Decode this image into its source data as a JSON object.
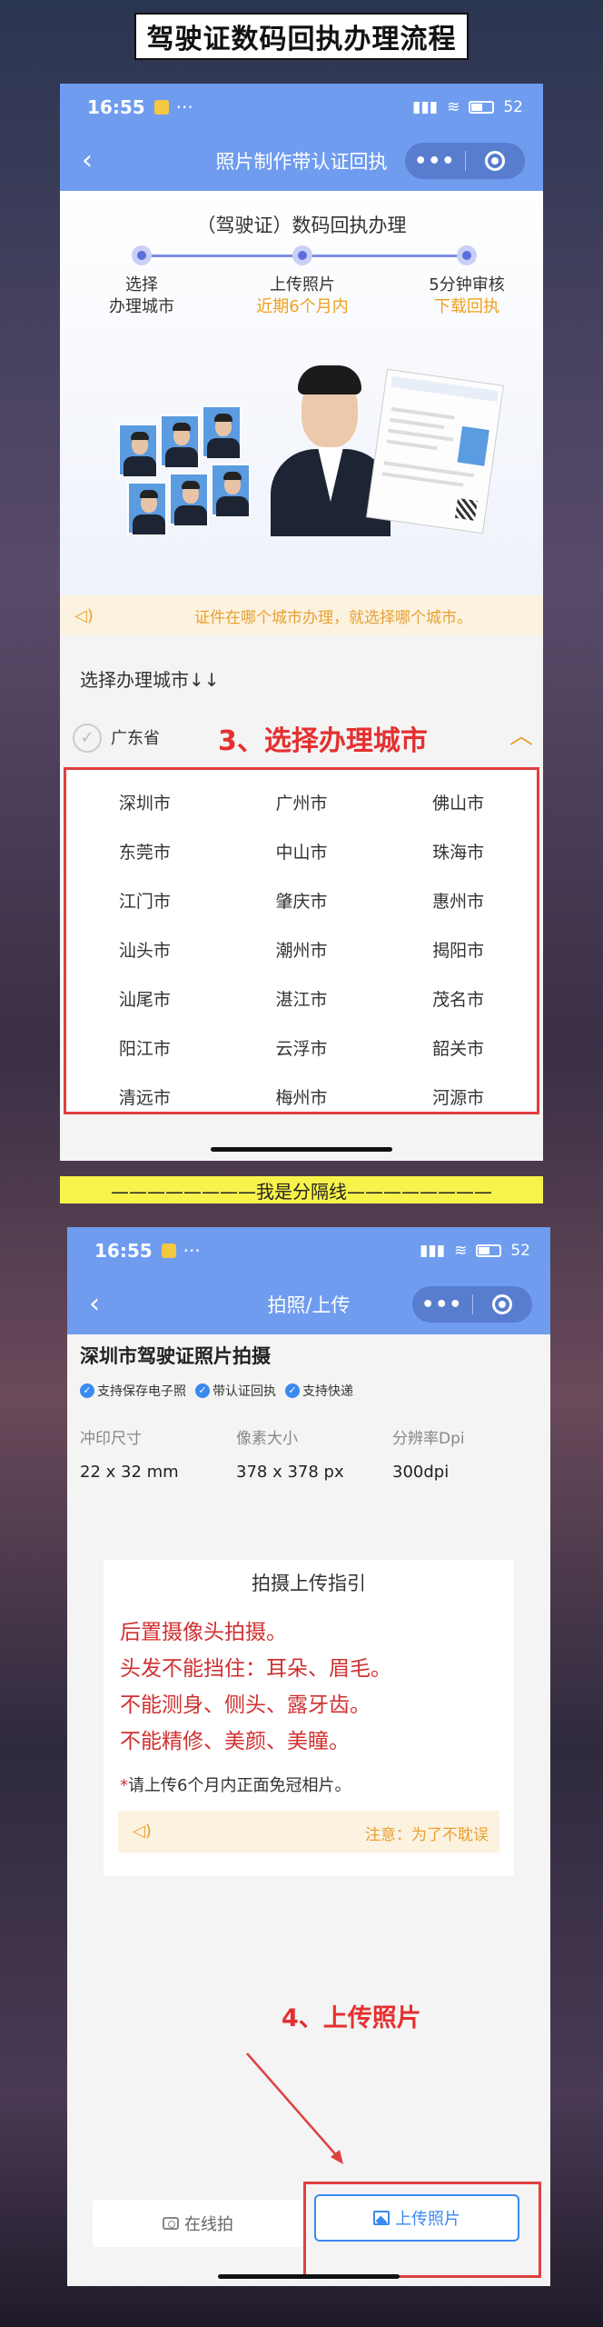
{
  "header_title": "驾驶证数码回执办理流程",
  "status_bar": {
    "time": "16:55",
    "notif_dots": "···",
    "battery": "52"
  },
  "screen1": {
    "nav_title": "照片制作带认证回执",
    "capsule_more": "•••",
    "hero_title": "（驾驶证）数码回执办理",
    "steps": [
      {
        "title": "选择",
        "sub": "办理城市",
        "sub_highlight": false
      },
      {
        "title": "上传照片",
        "sub": "近期6个月内",
        "sub_highlight": true
      },
      {
        "title": "5分钟审核",
        "sub": "下载回执",
        "sub_highlight": true
      }
    ],
    "notice": "证件在哪个城市办理，就选择哪个城市。",
    "section_label": "选择办理城市↓↓",
    "province": "广东省",
    "annotation": "3、选择办理城市",
    "cities": [
      "深圳市",
      "广州市",
      "佛山市",
      "东莞市",
      "中山市",
      "珠海市",
      "江门市",
      "肇庆市",
      "惠州市",
      "汕头市",
      "潮州市",
      "揭阳市",
      "汕尾市",
      "湛江市",
      "茂名市",
      "阳江市",
      "云浮市",
      "韶关市",
      "清远市",
      "梅州市",
      "河源市"
    ]
  },
  "separator": "————————我是分隔线————————",
  "screen2": {
    "nav_title": "拍照/上传",
    "capsule_more": "•••",
    "title": "深圳市驾驶证照片拍摄",
    "tags": [
      "支持保存电子照",
      "带认证回执",
      "支持快递"
    ],
    "specs": [
      {
        "label": "冲印尺寸",
        "value": "22 x 32 mm"
      },
      {
        "label": "像素大小",
        "value": "378 x 378 px"
      },
      {
        "label": "分辨率Dpi",
        "value": "300dpi"
      }
    ],
    "guide_title": "拍摄上传指引",
    "guide_lines": [
      "后置摄像头拍摄。",
      "头发不能挡住：耳朵、眉毛。",
      "不能测身、侧头、露牙齿。",
      "不能精修、美颜、美瞳。"
    ],
    "guide_note_star": "*",
    "guide_note": "请上传6个月内正面免冠相片。",
    "guide_notice": "注意：为了不耽误",
    "annotation": "4、上传照片",
    "btn_online": "在线拍",
    "btn_upload": "上传照片"
  },
  "colors": {
    "brand_blue": "#6f9cef",
    "alert_red": "#e04040",
    "notice_orange": "#e8a030",
    "separator_yellow": "#f7f34a"
  }
}
